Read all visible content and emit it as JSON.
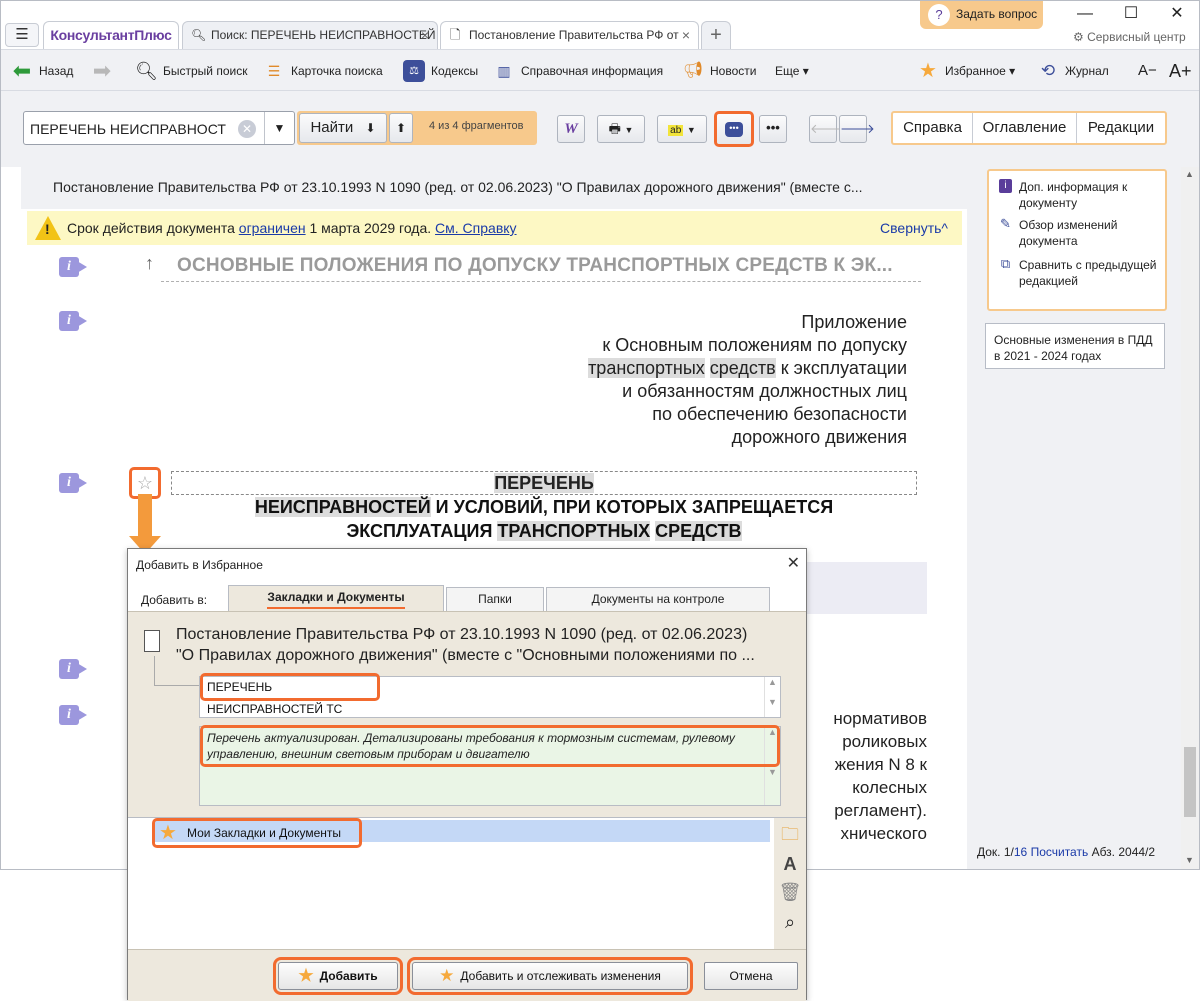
{
  "app": {
    "logo": "КонсультантПлюс",
    "menu_icon": "hamburger-icon",
    "tabs": [
      {
        "label": "Поиск: ПЕРЕЧЕНЬ НЕИСПРАВНОСТЕЙ",
        "icon": "search-icon"
      },
      {
        "label": "Постановление Правительства РФ от",
        "icon": "document-icon",
        "active": true
      }
    ],
    "ask_question": "Задать вопрос",
    "service_center": "Сервисный центр"
  },
  "toolbar": {
    "back": "Назад",
    "quick_search": "Быстрый поиск",
    "search_card": "Карточка поиска",
    "codes": "Кодексы",
    "reference": "Справочная информация",
    "news": "Новости",
    "more": "Еще",
    "favorites": "Избранное",
    "journal": "Журнал",
    "font_decrease": "A−",
    "font_increase": "A+"
  },
  "search": {
    "value": "ПЕРЕЧЕНЬ НЕИСПРАВНОСТ",
    "find_label": "Найти",
    "fragments": "4 из 4 фрагментов"
  },
  "right_tabs": [
    "Справка",
    "Оглавление",
    "Редакции"
  ],
  "document": {
    "header": "Постановление Правительства РФ от 23.10.1993 N 1090 (ред. от 02.06.2023) \"О Правилах дорожного движения\" (вместе с...",
    "warning_prefix": "Срок действия документа ",
    "warning_link": "ограничен",
    "warning_mid": " 1 марта 2029 года. ",
    "warning_link2": "См. Справку",
    "collapse": "Свернуть",
    "section_heading": "ОСНОВНЫЕ ПОЛОЖЕНИЯ ПО ДОПУСКУ ТРАНСПОРТНЫХ СРЕДСТВ К ЭК...",
    "appendix_lines": [
      "Приложение",
      "к Основным положениям по допуску",
      "транспортных средств к эксплуатации",
      "и обязанностям должностных лиц",
      "по обеспечению безопасности",
      "дорожного движения"
    ],
    "title_line1": "ПЕРЕЧЕНЬ",
    "title_line2": "НЕИСПРАВНОСТЕЙ И УСЛОВИЙ, ПРИ КОТОРЫХ ЗАПРЕЩАЕТСЯ",
    "title_line3": "ЭКСПЛУАТАЦИЯ ТРАНСПОРТНЫХ СРЕДСТВ",
    "body_fragments": [
      "нормативов",
      "роликовых",
      "жения N 8 к",
      "колесных",
      "регламент).",
      "хнического"
    ]
  },
  "right_panel": {
    "items": [
      "Доп. информация к документу",
      "Обзор изменений документа",
      "Сравнить с предыдущей редакцией"
    ],
    "changes": "Основные изменения в ПДД в 2021 - 2024 годах",
    "status_doc": "Док. 1/",
    "status_total": "16",
    "status_count": "Посчитать",
    "status_abz": "Абз. 2044/2"
  },
  "dialog": {
    "title": "Добавить в Избранное",
    "add_to": "Добавить в:",
    "tabs": [
      "Закладки и Документы",
      "Папки",
      "Документы на контроле"
    ],
    "doc_title_line1": "Постановление Правительства РФ от 23.10.1993 N 1090 (ред. от 02.06.2023)",
    "doc_title_line2": "\"О Правилах дорожного движения\" (вместе с \"Основными положениями по ...",
    "bookmark_name": "ПЕРЕЧЕНЬ НЕИСПРАВНОСТЕЙ ТС",
    "comment": "Перечень актуализирован. Детализированы требования к тормозным системам, рулевому управлению, внешним световым приборам и двигателю",
    "folder": "Мои Закладки и Документы",
    "btn_add": "Добавить",
    "btn_add_track": "Добавить и отслеживать изменения",
    "btn_cancel": "Отмена"
  }
}
